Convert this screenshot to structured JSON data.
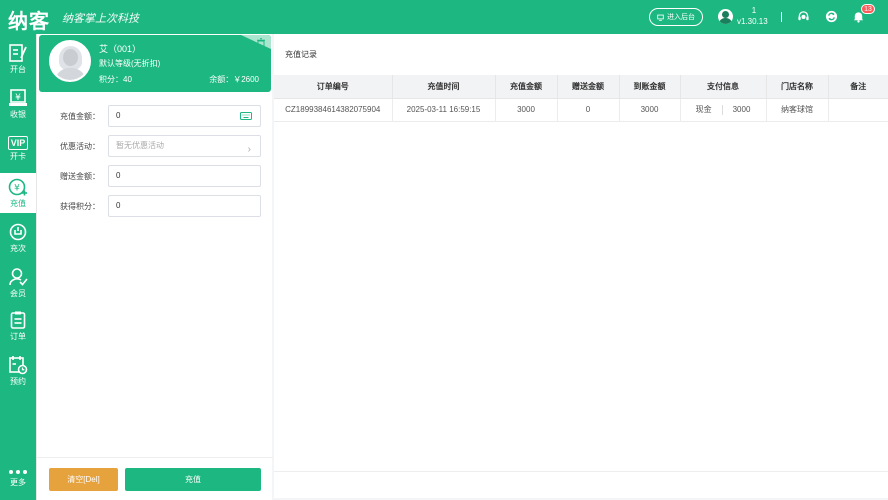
{
  "topbar": {
    "logo": "纳客",
    "slogan": "纳客掌上次科技",
    "backend_label": "进入后台",
    "user_name": "1",
    "version": "v1.30.13",
    "notification_count": "13",
    "accent_color": "#1db882"
  },
  "sidenav": {
    "items": [
      {
        "label": "开台",
        "icon": "open-table-icon"
      },
      {
        "label": "收银",
        "icon": "cashier-icon"
      },
      {
        "label": "开卡",
        "icon": "vip-card-icon",
        "badge_text": "VIP"
      },
      {
        "label": "充值",
        "icon": "recharge-icon",
        "active": true
      },
      {
        "label": "充次",
        "icon": "recharge-times-icon"
      },
      {
        "label": "会员",
        "icon": "member-icon"
      },
      {
        "label": "订单",
        "icon": "order-icon"
      },
      {
        "label": "预约",
        "icon": "reservation-icon"
      }
    ],
    "more_label": "更多"
  },
  "member": {
    "name": "艾（001）",
    "level": "默认等级(无折扣)",
    "points": "积分：40",
    "balance": "余额：￥2600"
  },
  "form": {
    "recharge_amount_label": "充值金额：",
    "recharge_amount_value": "0",
    "promotion_label": "优惠活动：",
    "promotion_placeholder": "暂无优惠活动",
    "gift_amount_label": "赠送金额：",
    "gift_amount_value": "0",
    "points_label": "获得积分：",
    "points_value": "0"
  },
  "footer": {
    "clear_label": "清空[Del]",
    "recharge_label": "充值"
  },
  "records": {
    "title": "充值记录",
    "headers": [
      "订单编号",
      "充值时间",
      "充值金额",
      "赠送金额",
      "到账金额",
      "支付信息",
      "门店名称",
      "备注"
    ],
    "rows": [
      {
        "order_no": "CZ1899384614382075904",
        "time": "2025-03-11 16:59:15",
        "amount": "3000",
        "gift": "0",
        "received": "3000",
        "pay_method": "现金",
        "pay_amount": "3000",
        "store": "纳客球馆",
        "note": ""
      }
    ]
  }
}
